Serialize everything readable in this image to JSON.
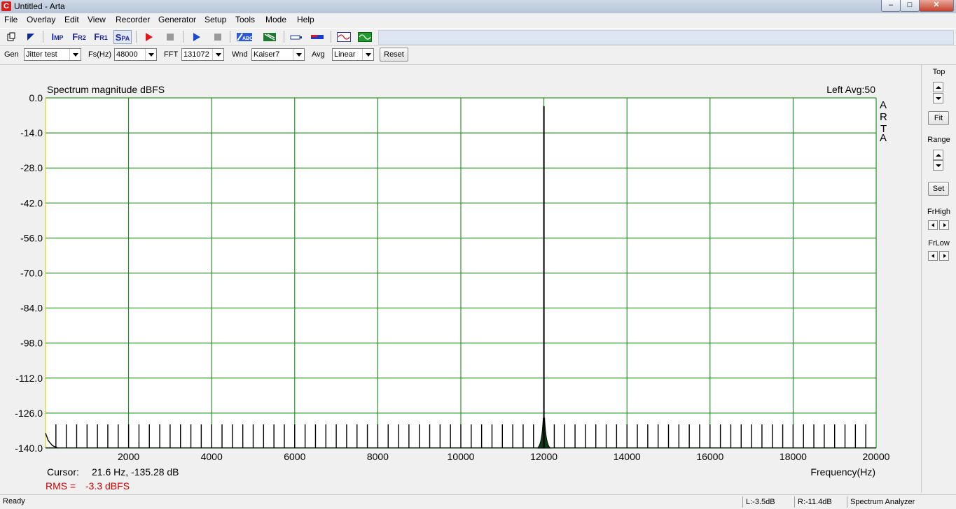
{
  "window": {
    "title": "Untitled - Arta",
    "app_icon": "C"
  },
  "menu": [
    "File",
    "Overlay",
    "Edit",
    "View",
    "Recorder",
    "Generator",
    "Setup",
    "Tools",
    "Mode",
    "Help"
  ],
  "toolbar_icons": [
    "new-icon",
    "open-icon",
    "impulse-mode-icon",
    "fr2-mode-icon",
    "fr1-mode-icon",
    "spa-mode-icon",
    "record-icon",
    "stop-icon",
    "play-icon",
    "stop2-icon",
    "abc-icon",
    "calibrate-icon",
    "scope-icon",
    "colors-icon",
    "sine-icon",
    "green-wave-icon"
  ],
  "toolbar_modes": {
    "imp": "I",
    "imp_sub": "MP",
    "fr2": "F",
    "fr2_sub": "R2",
    "fr1": "F",
    "fr1_sub": "R1",
    "spa": "S",
    "spa_sub": "PA"
  },
  "controls": {
    "gen_label": "Gen",
    "gen_value": "Jitter test",
    "fs_label": "Fs(Hz)",
    "fs_value": "48000",
    "fft_label": "FFT",
    "fft_value": "131072",
    "wnd_label": "Wnd",
    "wnd_value": "Kaiser7",
    "avg_label": "Avg",
    "avg_value": "Linear",
    "reset_label": "Reset"
  },
  "right_panel": {
    "top_label": "Top",
    "fit_label": "Fit",
    "range_label": "Range",
    "set_label": "Set",
    "frhigh_label": "FrHigh",
    "frlow_label": "FrLow"
  },
  "plot": {
    "title": "Spectrum magnitude dBFS",
    "channel_info": "Left  Avg:50",
    "watermark": [
      "A",
      "R",
      "T",
      "A"
    ],
    "cursor_label": "Cursor:",
    "cursor_value": "21.6 Hz, -135.28 dB",
    "rms_label": "RMS =",
    "rms_value": "-3.3 dBFS",
    "xaxis_label": "Frequency(Hz)",
    "grid_color": "#008000",
    "trace_color": "#000000",
    "rms_color": "#cc0000"
  },
  "chart_data": {
    "type": "line",
    "title": "Spectrum magnitude dBFS",
    "xlabel": "Frequency(Hz)",
    "ylabel": "",
    "xlim": [
      0,
      20000
    ],
    "ylim": [
      -140,
      0
    ],
    "x_ticks": [
      "2000",
      "4000",
      "6000",
      "8000",
      "10000",
      "12000",
      "14000",
      "16000",
      "18000",
      "20000"
    ],
    "y_ticks": [
      "0.0",
      "-14.0",
      "-28.0",
      "-42.0",
      "-56.0",
      "-70.0",
      "-84.0",
      "-98.0",
      "-112.0",
      "-126.0",
      "-140.0"
    ],
    "grid": true,
    "main_tone": {
      "x": 12000,
      "y": -3.3
    },
    "jitter_tones": {
      "start": 0,
      "step": 250,
      "end": 20000,
      "y": -130.5
    },
    "noise_floor": -140
  },
  "status": {
    "left": "Ready",
    "l_level": "L:-3.5dB",
    "r_level": "R:-11.4dB",
    "mode": "Spectrum Analyzer"
  }
}
